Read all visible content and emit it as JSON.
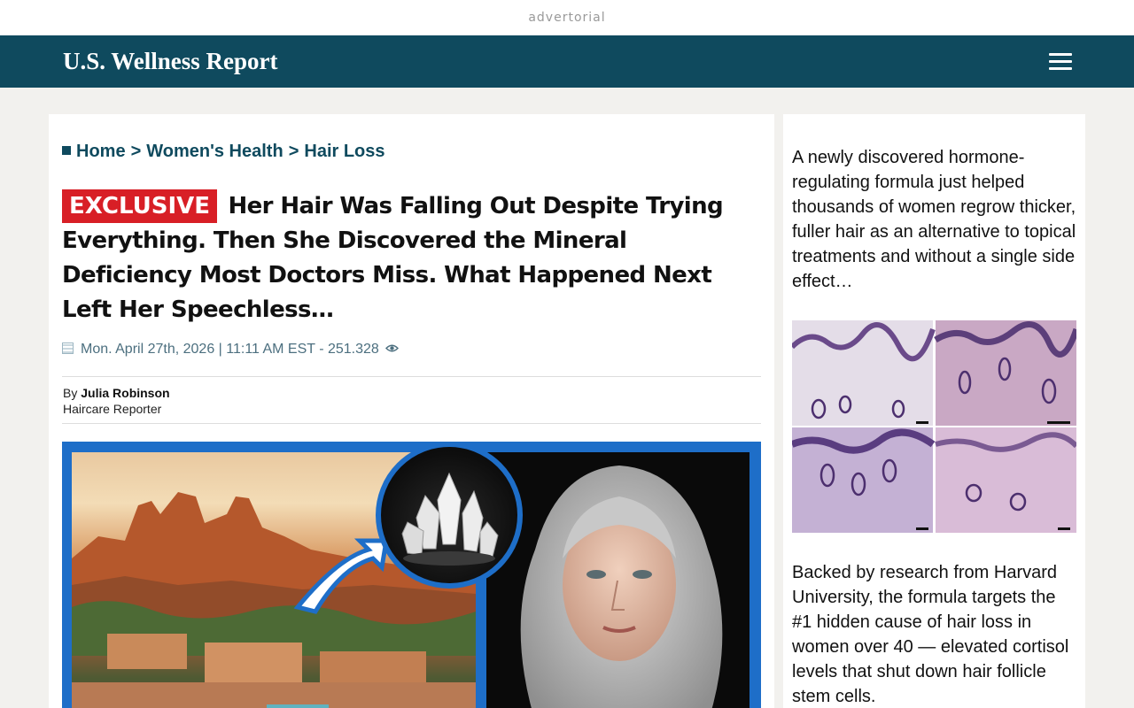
{
  "ad_label": "advertorial",
  "header": {
    "brand": "U.S. Wellness Report",
    "menu_icon": "hamburger-menu-icon"
  },
  "breadcrumb": {
    "items": [
      "Home",
      "Women's Health",
      "Hair Loss"
    ],
    "separator": ">"
  },
  "article": {
    "badge": "EXCLUSIVE",
    "headline": "Her Hair Was Falling Out Despite Trying Everything. Then She Discovered the Mineral Deficiency Most Doctors Miss. What Happened Next Left Her Speechless…",
    "meta": "Mon. April 27th, 2026 | 11:11 AM EST - 251.328",
    "by_label": "By",
    "author": "Julia Robinson",
    "author_role": "Haircare Reporter",
    "views_icon": "eye-icon",
    "date_icon": "calendar-icon"
  },
  "sidebar": {
    "intro": "A newly discovered hormone-regulating formula just helped thousands of women regrow thicker, fuller hair as an alternative to topical treatments and without a single side effect…",
    "research": "Backed by research from Harvard University, the formula targets the #1 hidden cause of hair loss in women over 40 — elevated cortisol levels that shut down hair follicle stem cells."
  },
  "colors": {
    "brand": "#0f4a5e",
    "badge": "#d81f26",
    "hero_frame": "#1e6ec8",
    "page_bg": "#f2f1ee"
  }
}
